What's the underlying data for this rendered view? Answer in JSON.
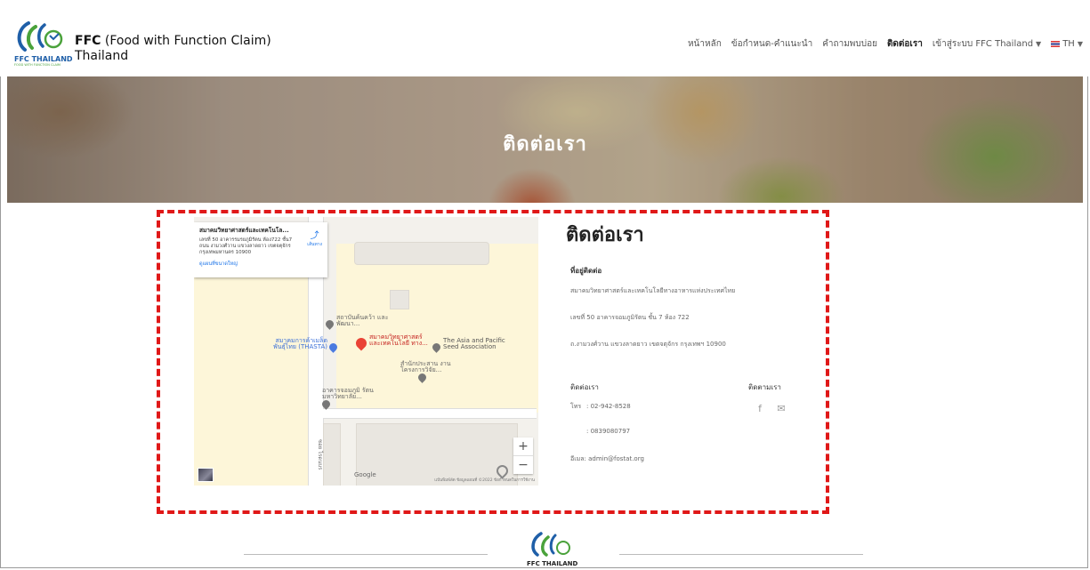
{
  "header": {
    "logo_text": "FFC THAILAND",
    "logo_sub": "FOOD WITH FUNCTION CLAIM",
    "brand_bold": "FFC",
    "brand_rest": " (Food with Function Claim)",
    "brand_line2": "Thailand"
  },
  "nav": {
    "items": [
      "หน้าหลัก",
      "ข้อกำหนด-คำแนะนำ",
      "คำถามพบบ่อย",
      "ติดต่อเรา",
      "เข้าสู่ระบบ FFC Thailand",
      "TH"
    ],
    "active": "ติดต่อเรา"
  },
  "hero": {
    "title": "ติดต่อเรา"
  },
  "map": {
    "card_title": "สมาคมวิทยาศาสตร์และเทคโนโล...",
    "card_address": "เลขที่ 50 อาคารรมรยภูมิรัตน ห้อง722 ชั้น7 ถนน งามวงศ์วาน แขวงลาดยาว เขตจตุจักร กรุงเทพมหานคร 10900",
    "card_link": "ดูแผนที่ขนาดใหญ่",
    "directions": "เส้นทาง",
    "pins": {
      "p1": "สถาบันค้นคว้า และพัฒนา...",
      "p2": "สมาคมการค้าเมล็ด พันธุ์ไทย (THASTA)",
      "p3": "สมาคมวิทยาศาสตร์ และเทคโนโลยี ทาง...",
      "p4": "The Asia and Pacific Seed Association",
      "p5": "สำนักประสาน งานโครงการวิจัย...",
      "p6": "อาคารจอมภูมิ รัตน มหาวิทยาลัย..."
    },
    "road_label": "ซอย ไรดนบร",
    "zoom_in": "+",
    "zoom_out": "−",
    "google": "Google",
    "footer": "แป้นพิมพ์ลัด   ข้อมูลแผนที่ ©2022   ข้อกำหนดในการใช้งาน"
  },
  "contact": {
    "title": "ติดต่อเรา",
    "address_heading": "ที่อยู่ติดต่อ",
    "address_lines": [
      "สมาคมวิทยาศาสตร์และเทคโนโลยีทางอาหารแห่งประเทศไทย",
      "เลขที่ 50 อาคารจอมภูมิรัตน ชั้น 7 ห้อง 722",
      "ถ.งามวงศ์วาน แขวงลาดยาว เขตจตุจักร กรุงเทพฯ 10900"
    ],
    "contact_heading": "ติดต่อเรา",
    "follow_heading": "ติดตามเรา",
    "phone_label": "โทร",
    "phone1": ": 02-942-8528",
    "phone2": ": 0839080797",
    "email_label": "อีเมล",
    "email": ": admin@fostat.org"
  },
  "icons": {
    "social": [
      "facebook-icon",
      "email-icon"
    ]
  },
  "colors": {
    "highlight_border": "#e01818",
    "logo_blue": "#1f5fa8",
    "logo_green": "#4aa23b"
  }
}
